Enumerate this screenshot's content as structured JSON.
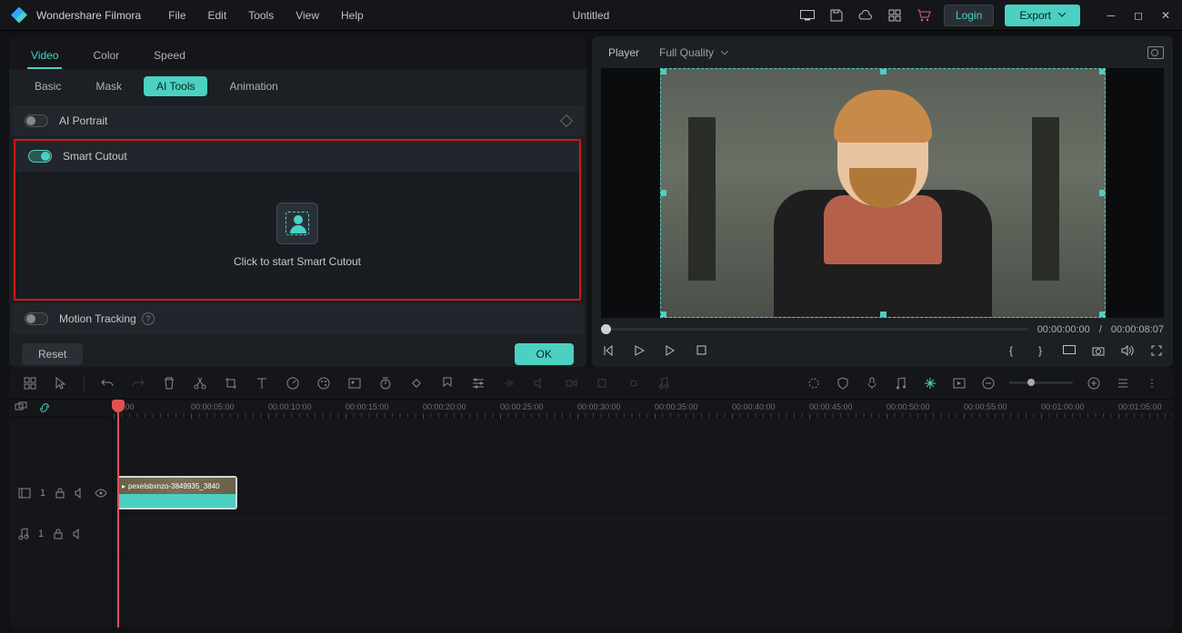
{
  "app": {
    "name": "Wondershare Filmora",
    "doc_title": "Untitled"
  },
  "menu": {
    "file": "File",
    "edit": "Edit",
    "tools": "Tools",
    "view": "View",
    "help": "Help"
  },
  "titlebar": {
    "login": "Login",
    "export": "Export"
  },
  "tabs": {
    "video": "Video",
    "color": "Color",
    "speed": "Speed"
  },
  "subtabs": {
    "basic": "Basic",
    "mask": "Mask",
    "ai_tools": "AI Tools",
    "animation": "Animation"
  },
  "sections": {
    "ai_portrait": "AI Portrait",
    "smart_cutout": "Smart Cutout",
    "smart_cutout_hint": "Click to start Smart Cutout",
    "motion_tracking": "Motion Tracking"
  },
  "buttons": {
    "reset": "Reset",
    "ok": "OK"
  },
  "player": {
    "label": "Player",
    "quality": "Full Quality",
    "current": "00:00:00:00",
    "sep": "/",
    "duration": "00:00:08:07"
  },
  "ruler": [
    "00:00",
    "00:00:05:00",
    "00:00:10:00",
    "00:00:15:00",
    "00:00:20:00",
    "00:00:25:00",
    "00:00:30:00",
    "00:00:35:00",
    "00:00:40:00",
    "00:00:45:00",
    "00:00:50:00",
    "00:00:55:00",
    "00:01:00:00",
    "00:01:05:00"
  ],
  "tracks": {
    "video": "1",
    "audio": "1"
  },
  "clip": {
    "name": "pexelsbxnzo-3849935_3840"
  }
}
